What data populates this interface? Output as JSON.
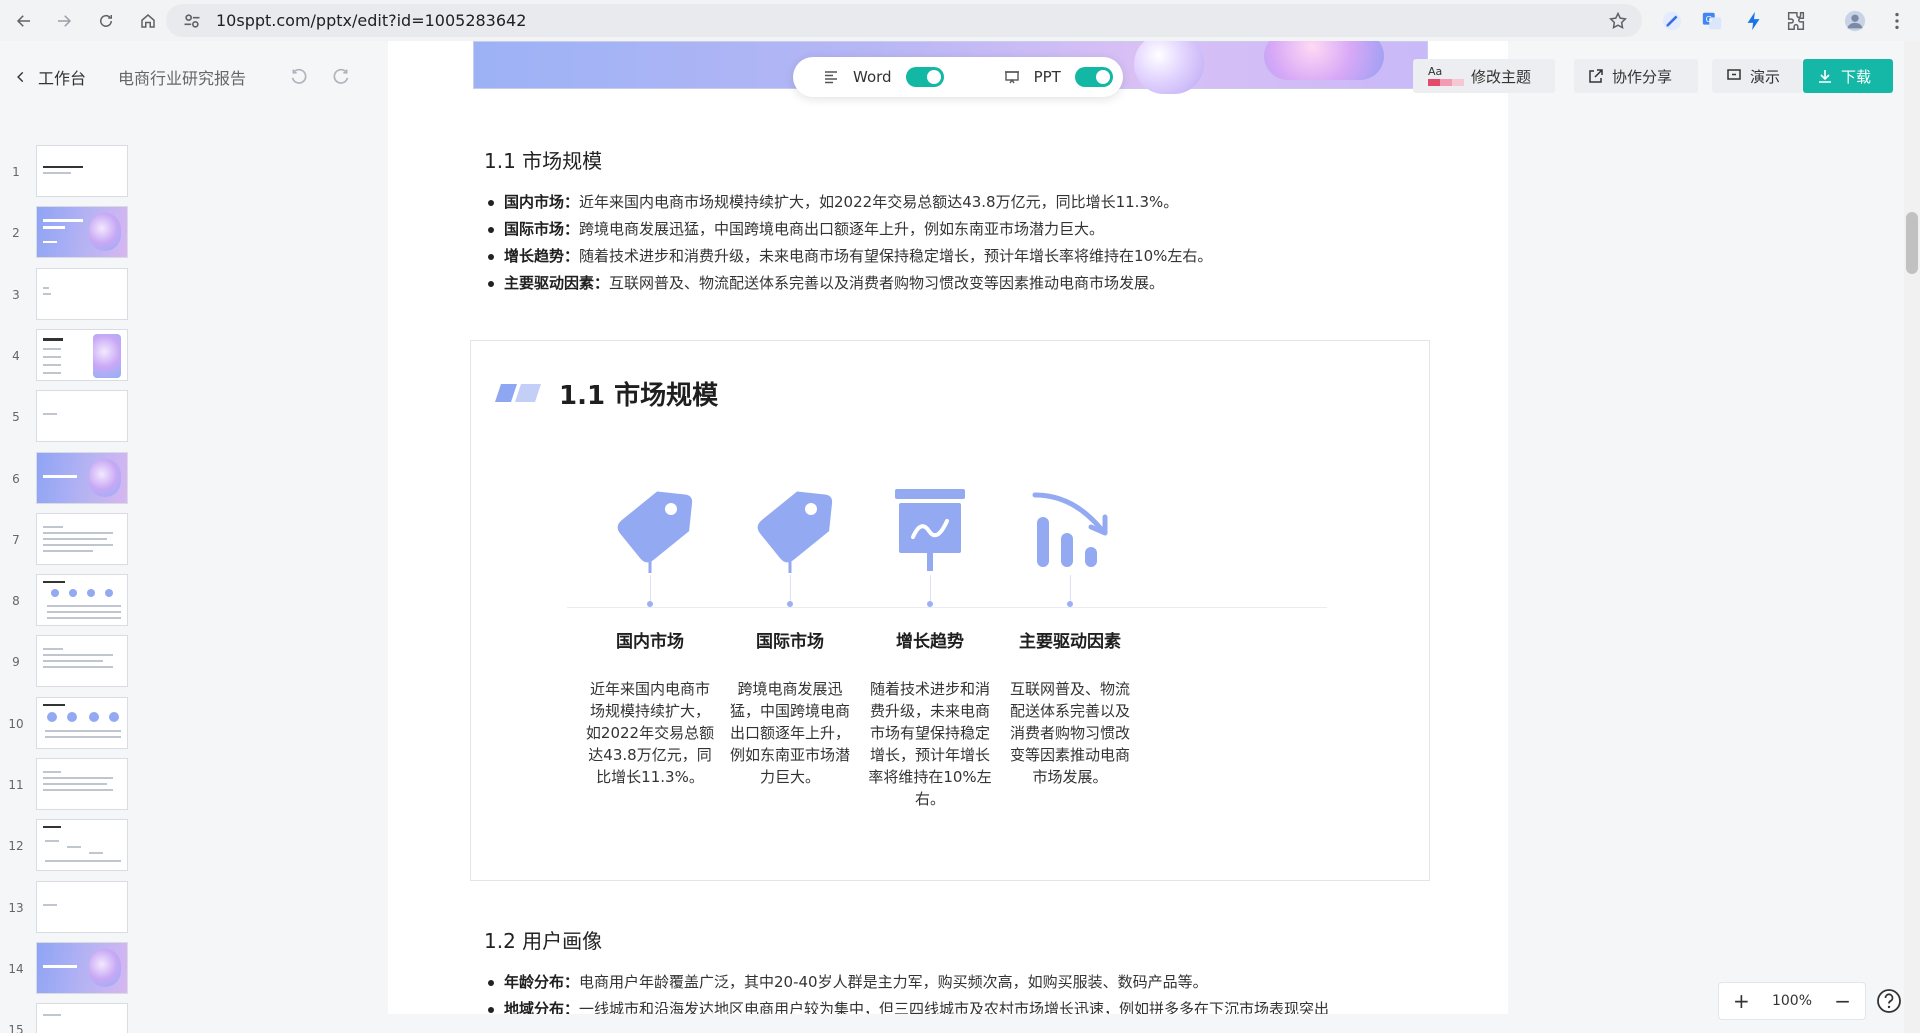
{
  "browser": {
    "url": "10sppt.com/pptx/edit?id=1005283642"
  },
  "app": {
    "back_label": "工作台",
    "doc_title": "电商行业研究报告",
    "toggles": [
      {
        "label": "Word",
        "on": true
      },
      {
        "label": "PPT",
        "on": true
      }
    ],
    "toolbar": {
      "theme": "修改主题",
      "share": "协作分享",
      "present": "演示",
      "download": "下载"
    },
    "theme_badge": "Aa",
    "zoom": "100%",
    "accent": "#15b8a6",
    "icon_color": "#93a9f2"
  },
  "thumbnails": [
    "1",
    "2",
    "3",
    "4",
    "5",
    "6",
    "7",
    "8",
    "9",
    "10",
    "11",
    "12",
    "13",
    "14",
    "15"
  ],
  "section1": {
    "heading": "1.1 市场规模",
    "bullets": [
      {
        "label": "国内市场：",
        "text": "近年来国内电商市场规模持续扩大，如2022年交易总额达43.8万亿元，同比增长11.3%。"
      },
      {
        "label": "国际市场：",
        "text": "跨境电商发展迅猛，中国跨境电商出口额逐年上升，例如东南亚市场潜力巨大。"
      },
      {
        "label": "增长趋势：",
        "text": "随着技术进步和消费升级，未来电商市场有望保持稳定增长，预计年增长率将维持在10%左右。"
      },
      {
        "label": "主要驱动因素：",
        "text": "互联网普及、物流配送体系完善以及消费者购物习惯改变等因素推动电商市场发展。"
      }
    ]
  },
  "slide": {
    "title": "1.1 市场规模",
    "columns": [
      {
        "icon": "tag-icon",
        "label": "国内市场",
        "desc": "近年来国内电商市场规模持续扩大，如2022年交易总额达43.8万亿元，同比增长11.3%。"
      },
      {
        "icon": "tag-icon",
        "label": "国际市场",
        "desc": "跨境电商发展迅猛，中国跨境电商出口额逐年上升，例如东南亚市场潜力巨大。"
      },
      {
        "icon": "presentation-chart-icon",
        "label": "增长趋势",
        "desc": "随着技术进步和消费升级，未来电商市场有望保持稳定增长，预计年增长率将维持在10%左右。"
      },
      {
        "icon": "bar-chart-trend-icon",
        "label": "主要驱动因素",
        "desc": "互联网普及、物流配送体系完善以及消费者购物习惯改变等因素推动电商市场发展。"
      }
    ]
  },
  "section2": {
    "heading": "1.2 用户画像",
    "bullets": [
      {
        "label": "年龄分布：",
        "text": "电商用户年龄覆盖广泛，其中20-40岁人群是主力军，购买频次高，如购买服装、数码产品等。"
      },
      {
        "label": "地域分布：",
        "text": "一线城市和沿海发达地区电商用户较为集中，但三四线城市及农村市场增长迅速，例如拼多多在下沉市场表现突出"
      }
    ]
  }
}
